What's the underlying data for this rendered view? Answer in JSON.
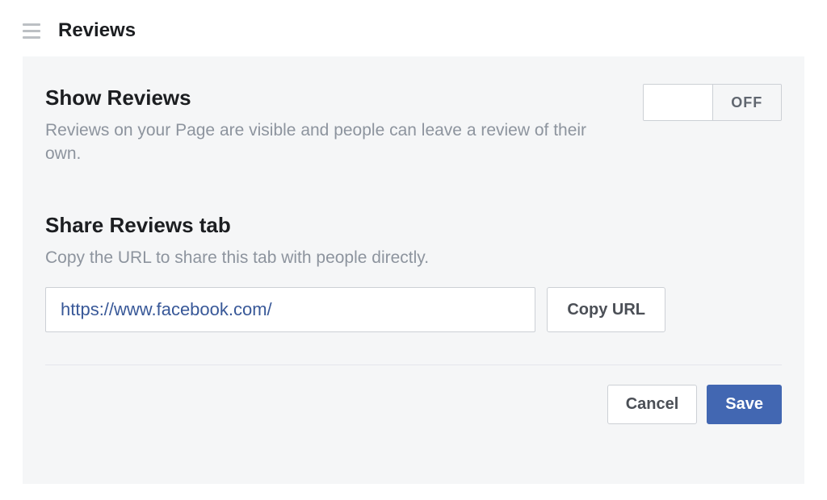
{
  "header": {
    "title": "Reviews"
  },
  "show_reviews": {
    "heading": "Show Reviews",
    "description": "Reviews on your Page are visible and people can leave a review of their own.",
    "toggle_state": "OFF"
  },
  "share_tab": {
    "heading": "Share Reviews tab",
    "description": "Copy the URL to share this tab with people directly.",
    "url_value": "https://www.facebook.com/",
    "copy_label": "Copy URL"
  },
  "actions": {
    "cancel": "Cancel",
    "save": "Save"
  }
}
